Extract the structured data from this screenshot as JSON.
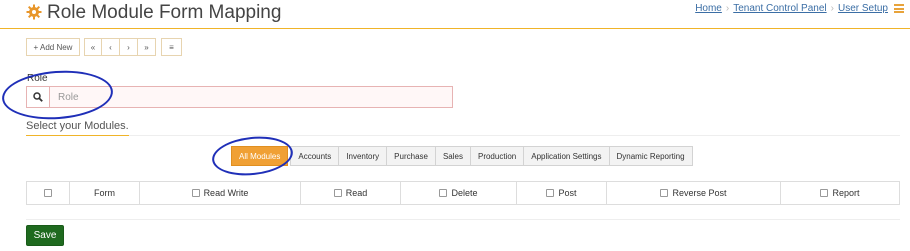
{
  "header": {
    "title": "Role Module Form Mapping",
    "breadcrumb": [
      {
        "label": "Home"
      },
      {
        "label": "Tenant Control Panel"
      },
      {
        "label": "User Setup"
      }
    ],
    "breadcrumb_separator": "›"
  },
  "toolbar": {
    "add_new": "+ Add New",
    "first": "«",
    "prev": "‹",
    "next": "›",
    "last": "»",
    "list": "≡"
  },
  "role": {
    "label": "Role",
    "placeholder": "Role"
  },
  "modules": {
    "heading": "Select your Modules.",
    "tabs": [
      {
        "label": "All Modules",
        "active": true
      },
      {
        "label": "Accounts"
      },
      {
        "label": "Inventory"
      },
      {
        "label": "Purchase"
      },
      {
        "label": "Sales"
      },
      {
        "label": "Production"
      },
      {
        "label": "Application Settings"
      },
      {
        "label": "Dynamic Reporting"
      }
    ]
  },
  "table": {
    "columns": [
      {
        "label": ""
      },
      {
        "label": "Form"
      },
      {
        "label": "Read Write"
      },
      {
        "label": "Read"
      },
      {
        "label": "Delete"
      },
      {
        "label": "Post"
      },
      {
        "label": "Reverse Post"
      },
      {
        "label": "Report"
      }
    ]
  },
  "save_label": "Save",
  "colors": {
    "accent": "#f0a034",
    "save": "#1f6a1f",
    "link": "#3b6ea5",
    "annotation": "#1f2fb8"
  }
}
